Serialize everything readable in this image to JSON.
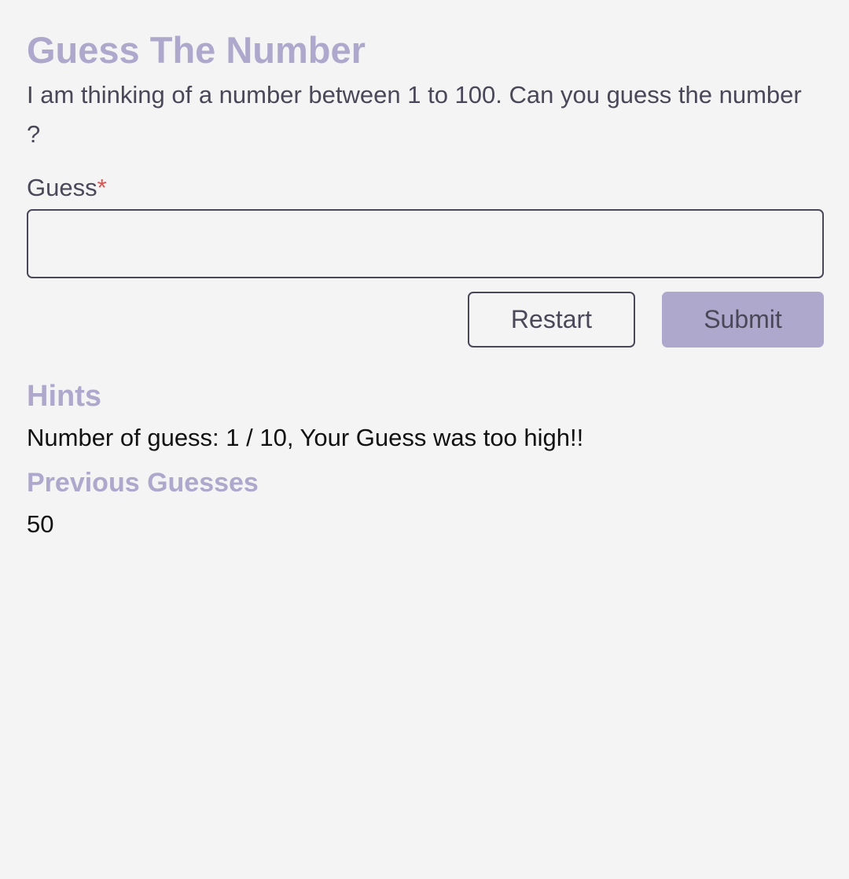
{
  "header": {
    "title": "Guess The Number",
    "description": "I am thinking of a number between 1 to 100. Can you guess the number ?"
  },
  "form": {
    "guess_label": "Guess",
    "required_marker": "*",
    "guess_value": "",
    "restart_label": "Restart",
    "submit_label": "Submit"
  },
  "hints": {
    "heading": "Hints",
    "text": "Number of guess: 1 / 10, Your Guess was too high!!"
  },
  "previous_guesses": {
    "heading": "Previous Guesses",
    "items": [
      "50"
    ]
  },
  "colors": {
    "accent": "#aea8cc",
    "background": "#f4f4f4",
    "text": "#4a4858",
    "required": "#d9534f"
  }
}
